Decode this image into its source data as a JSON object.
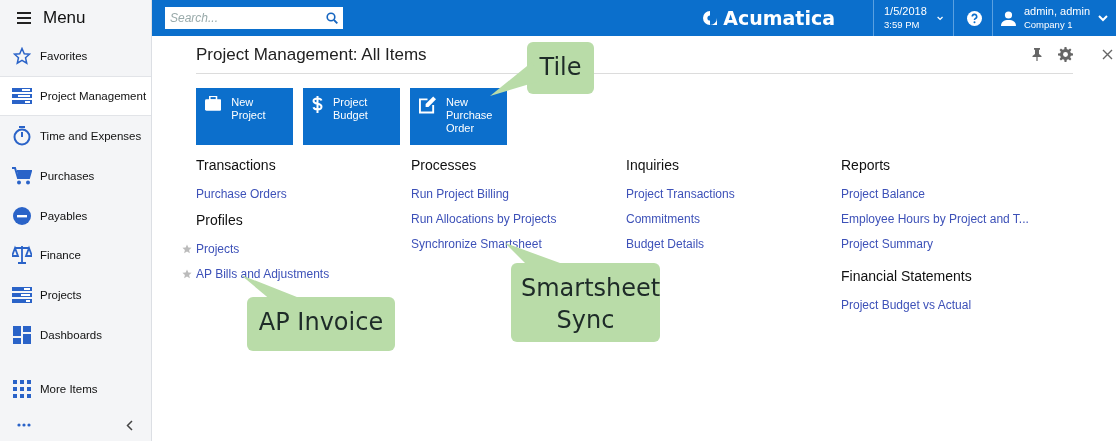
{
  "sidebar": {
    "title": "Menu",
    "items": [
      {
        "label": "Favorites",
        "selected": false
      },
      {
        "label": "Project Management",
        "selected": true
      },
      {
        "label": "Time and Expenses",
        "selected": false
      },
      {
        "label": "Purchases",
        "selected": false
      },
      {
        "label": "Payables",
        "selected": false
      },
      {
        "label": "Finance",
        "selected": false
      },
      {
        "label": "Projects",
        "selected": false
      },
      {
        "label": "Dashboards",
        "selected": false
      },
      {
        "label": "More Items",
        "selected": false
      }
    ]
  },
  "topbar": {
    "search": {
      "placeholder": "Search..."
    },
    "logo": "Acumatica",
    "date": "1/5/2018",
    "time": "3:59 PM",
    "user": "admin, admin",
    "company": "Company 1"
  },
  "workspace": {
    "title": "Project Management: All Items",
    "tiles": [
      {
        "label": "New Project"
      },
      {
        "label": "Project Budget"
      },
      {
        "label": "New Purchase Order"
      }
    ],
    "columns": [
      {
        "sections": [
          {
            "heading": "Transactions",
            "links": [
              {
                "label": "Purchase Orders"
              }
            ]
          },
          {
            "heading": "Profiles",
            "links": [
              {
                "label": "Projects",
                "favorite": false
              },
              {
                "label": "AP Bills and Adjustments",
                "favorite": false
              }
            ]
          }
        ]
      },
      {
        "sections": [
          {
            "heading": "Processes",
            "links": [
              {
                "label": "Run Project Billing"
              },
              {
                "label": "Run Allocations by Projects"
              },
              {
                "label": "Synchronize Smartsheet"
              }
            ]
          }
        ]
      },
      {
        "sections": [
          {
            "heading": "Inquiries",
            "links": [
              {
                "label": "Project Transactions"
              },
              {
                "label": "Commitments"
              },
              {
                "label": "Budget Details"
              }
            ]
          }
        ]
      },
      {
        "sections": [
          {
            "heading": "Reports",
            "links": [
              {
                "label": "Project Balance"
              },
              {
                "label": "Employee Hours by Project and T..."
              },
              {
                "label": "Project Summary"
              }
            ]
          },
          {
            "heading": "Financial Statements",
            "links": [
              {
                "label": "Project Budget vs Actual"
              }
            ]
          }
        ]
      }
    ]
  },
  "callouts": [
    {
      "text": "Tile"
    },
    {
      "text": "AP Invoice"
    },
    {
      "text": "Smartsheet Sync"
    }
  ]
}
